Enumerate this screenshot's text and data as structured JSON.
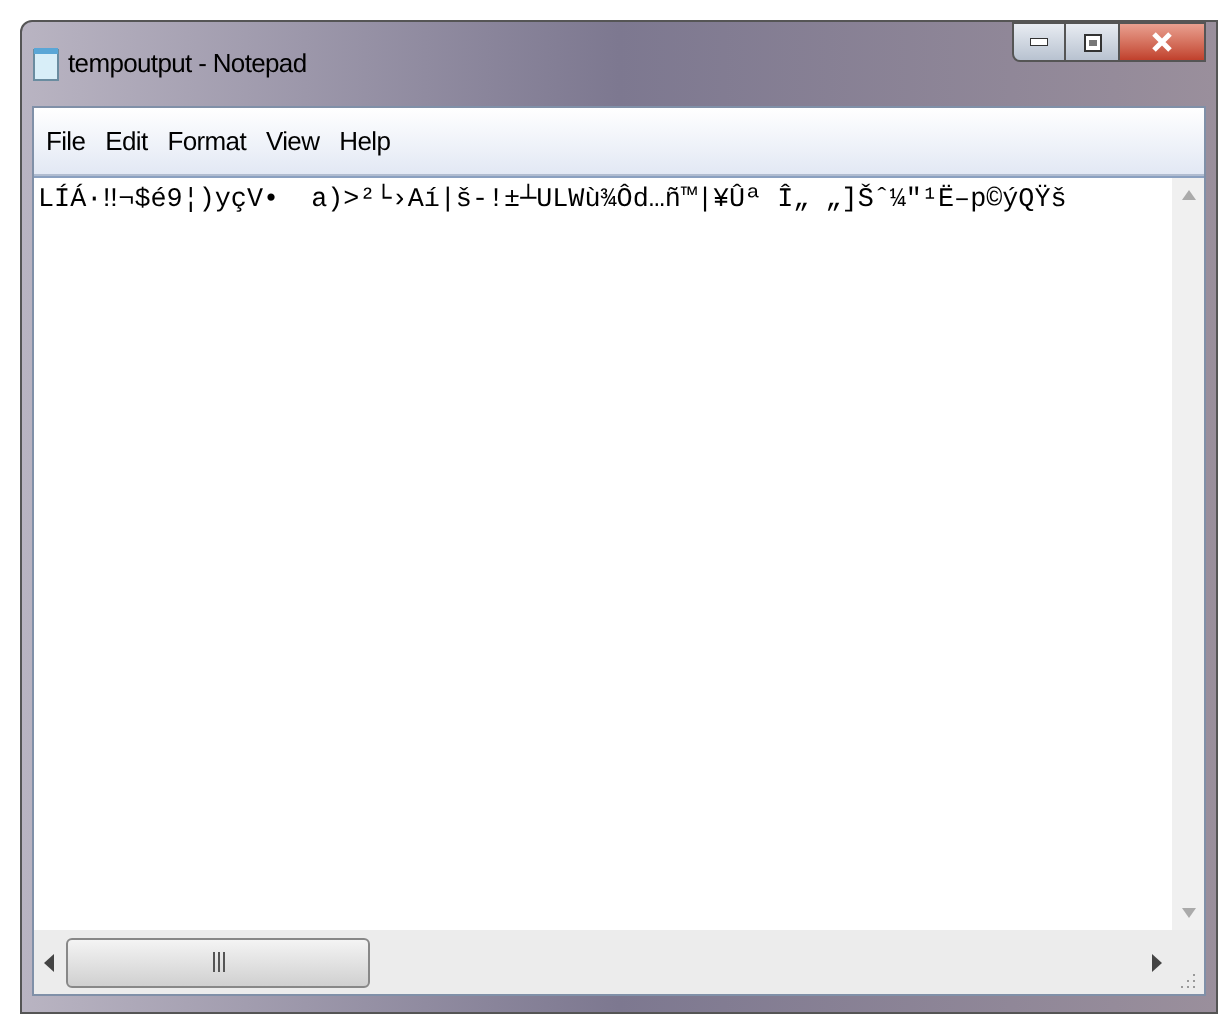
{
  "window": {
    "title": "tempoutput - Notepad"
  },
  "menu": [
    "File",
    "Edit",
    "Format",
    "View",
    "Help"
  ],
  "document": {
    "text": "LÍÁ·‼¬$é9¦)yçV•  a)>²└›Aí|š-!±┴ULWù¾Ôd…ñ™|¥Ûª Î„ „]Šˆ¼\"¹Ë–p©ýQŸš"
  }
}
